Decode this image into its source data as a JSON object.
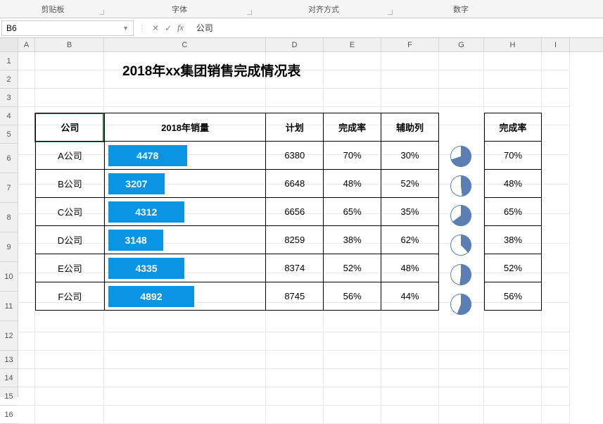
{
  "ribbon": {
    "groups": [
      "剪贴板",
      "字体",
      "对齐方式",
      "数字"
    ]
  },
  "nameBox": "B6",
  "formulaBar": "公司",
  "columns": [
    "A",
    "B",
    "C",
    "D",
    "E",
    "F",
    "G",
    "H",
    "I"
  ],
  "title": "2018年xx集团销售完成情况表",
  "headers": {
    "company": "公司",
    "sales": "2018年销量",
    "plan": "计划",
    "rate": "完成率",
    "aux": "辅助列",
    "rate2": "完成率"
  },
  "maxPlan": 8745,
  "rows": [
    {
      "company": "A公司",
      "sales": 4478,
      "plan": 6380,
      "rate": "70%",
      "aux": "30%",
      "pcent": 70
    },
    {
      "company": "B公司",
      "sales": 3207,
      "plan": 6648,
      "rate": "48%",
      "aux": "52%",
      "pcent": 48
    },
    {
      "company": "C公司",
      "sales": 4312,
      "plan": 6656,
      "rate": "65%",
      "aux": "35%",
      "pcent": 65
    },
    {
      "company": "D公司",
      "sales": 3148,
      "plan": 8259,
      "rate": "38%",
      "aux": "62%",
      "pcent": 38
    },
    {
      "company": "E公司",
      "sales": 4335,
      "plan": 8374,
      "rate": "52%",
      "aux": "48%",
      "pcent": 52
    },
    {
      "company": "F公司",
      "sales": 4892,
      "plan": 8745,
      "rate": "56%",
      "aux": "44%",
      "pcent": 56
    }
  ],
  "chart_data": {
    "type": "table",
    "title": "2018年xx集团销售完成情况表",
    "columns": [
      "公司",
      "2018年销量",
      "计划",
      "完成率",
      "辅助列"
    ],
    "data": [
      [
        "A公司",
        4478,
        6380,
        "70%",
        "30%"
      ],
      [
        "B公司",
        3207,
        6648,
        "48%",
        "52%"
      ],
      [
        "C公司",
        4312,
        6656,
        "65%",
        "35%"
      ],
      [
        "D公司",
        3148,
        8259,
        "38%",
        "62%"
      ],
      [
        "E公司",
        4335,
        8374,
        "52%",
        "48%"
      ],
      [
        "F公司",
        4892,
        8745,
        "56%",
        "44%"
      ]
    ]
  }
}
